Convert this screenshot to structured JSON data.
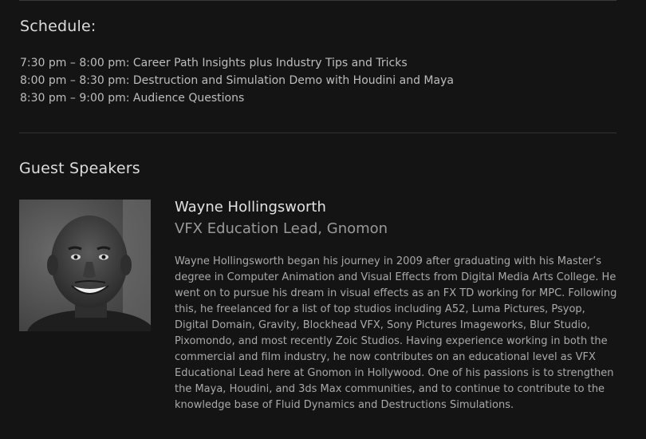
{
  "schedule": {
    "title": "Schedule:",
    "items": [
      "7:30 pm – 8:00 pm: Career Path Insights plus Industry Tips and Tricks",
      "8:00 pm – 8:30 pm: Destruction and Simulation Demo with Houdini and Maya",
      "8:30 pm – 9:00 pm: Audience Questions"
    ]
  },
  "speakers": {
    "title": "Guest Speakers",
    "items": [
      {
        "name": "Wayne Hollingsworth",
        "role": "VFX Education Lead, Gnomon",
        "bio": "Wayne Hollingsworth began his journey in 2009 after graduating with his Master’s degree in Computer Animation and Visual Effects from Digital Media Arts College. He went on to pursue his dream in visual effects as an FX TD working for MPC. Following this, he freelanced for a list of top studios including A52, Luma Pictures, Psyop, Digital Domain, Gravity, Blockhead VFX, Sony Pictures Imageworks, Blur Studio, Pixomondo, and most recently Zoic Studios. Having experience working in both the commercial and film industry, he now contributes on an educational level as VFX Educational Lead here at Gnomon in Hollywood. One of his passions is to strengthen the Maya, Houdini, and 3ds Max communities, and to continue to contribute to the knowledge base of Fluid Dynamics and Destructions Simulations."
      }
    ]
  },
  "colors": {
    "background": "#141414",
    "heading": "#dcdcdc",
    "body_text": "#bdbdbd",
    "muted_text": "#9a9a9a",
    "divider": "#333333"
  }
}
